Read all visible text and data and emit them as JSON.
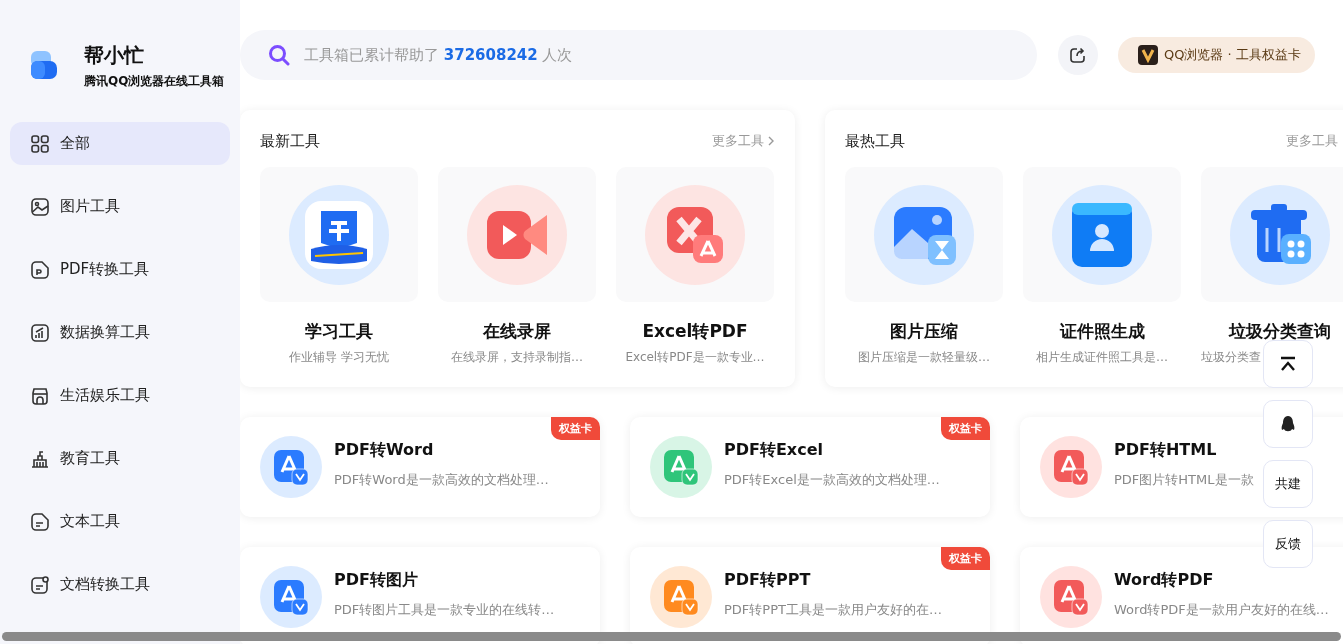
{
  "brand": {
    "name": "帮小忙",
    "subtitle": "腾讯QQ浏览器在线工具箱"
  },
  "sidebar": {
    "items": [
      {
        "label": "全部",
        "selected": true
      },
      {
        "label": "图片工具",
        "selected": false
      },
      {
        "label": "PDF转换工具",
        "selected": false
      },
      {
        "label": "数据换算工具",
        "selected": false
      },
      {
        "label": "生活娱乐工具",
        "selected": false
      },
      {
        "label": "教育工具",
        "selected": false
      },
      {
        "label": "文本工具",
        "selected": false
      },
      {
        "label": "文档转换工具",
        "selected": false
      }
    ]
  },
  "search": {
    "prefix": "工具箱已累计帮助了",
    "count": "372608242",
    "suffix": "人次"
  },
  "membership": {
    "label": "QQ浏览器 · 工具权益卡"
  },
  "sections": [
    {
      "title": "最新工具",
      "more": "更多工具",
      "arrow": true,
      "tools": [
        {
          "name": "学习工具",
          "description": "作业辅导 学习无忧"
        },
        {
          "name": "在线录屏",
          "description": "在线录屏，支持录制指…"
        },
        {
          "name": "Excel转PDF",
          "description": "Excel转PDF是一款专业…"
        }
      ]
    },
    {
      "title": "最热工具",
      "more": "更多工具",
      "arrow": false,
      "tools": [
        {
          "name": "图片压缩",
          "description": "图片压缩是一款轻量级…"
        },
        {
          "name": "证件照生成",
          "description": "相片生成证件照工具是…"
        },
        {
          "name": "垃圾分类查询",
          "description": "垃圾分类查"
        }
      ]
    }
  ],
  "tool_cards": [
    {
      "name": "PDF转Word",
      "description": "PDF转Word是一款高效的文档处理…",
      "premium": true,
      "badge": "权益卡"
    },
    {
      "name": "PDF转Excel",
      "description": "PDF转Excel是一款高效的文档处理…",
      "premium": true,
      "badge": "权益卡"
    },
    {
      "name": "PDF转HTML",
      "description": "PDF图片转HTML是一款",
      "premium": false
    },
    {
      "name": "PDF转图片",
      "description": "PDF转图片工具是一款专业的在线转…",
      "premium": false
    },
    {
      "name": "PDF转PPT",
      "description": "PDF转PPT工具是一款用户友好的在…",
      "premium": true,
      "badge": "权益卡"
    },
    {
      "name": "Word转PDF",
      "description": "Word转PDF是一款用户友好的在线…",
      "premium": false
    }
  ],
  "float_buttons": [
    {
      "kind": "top"
    },
    {
      "kind": "qq"
    },
    {
      "kind": "text",
      "label": "共建"
    },
    {
      "kind": "text",
      "label": "反馈"
    }
  ]
}
